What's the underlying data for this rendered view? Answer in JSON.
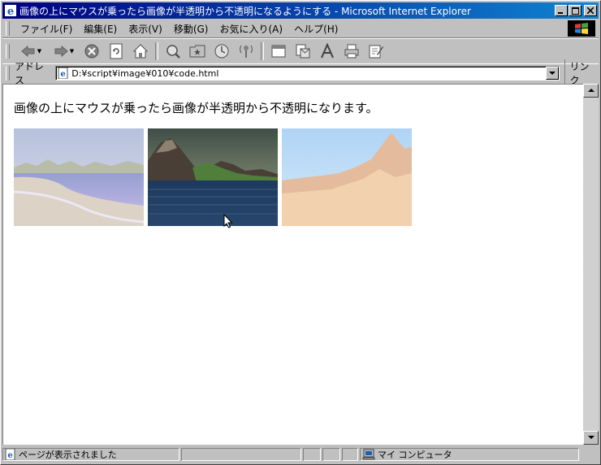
{
  "window": {
    "title": "画像の上にマウスが乗ったら画像が半透明から不透明になるようにする - Microsoft Internet Explorer"
  },
  "menu": [
    "ファイル(F)",
    "編集(E)",
    "表示(V)",
    "移動(G)",
    "お気に入り(A)",
    "ヘルプ(H)"
  ],
  "toolbar": {
    "buttons": [
      "back-icon",
      "forward-icon",
      "stop-icon",
      "refresh-icon",
      "home-icon",
      "search-icon",
      "favorites-icon",
      "history-icon",
      "channels-icon",
      "fullscreen-icon",
      "mail-icon",
      "font-icon",
      "print-icon",
      "edit-icon"
    ]
  },
  "address": {
    "label": "アドレス",
    "value": "D:¥script¥image¥010¥code.html",
    "links_label": "リンク"
  },
  "page": {
    "heading": "画像の上にマウスが乗ったら画像が半透明から不透明になります。",
    "images": [
      {
        "name": "beach-landscape",
        "opacity": 0.5
      },
      {
        "name": "mountain-sea-landscape",
        "opacity": 1.0
      },
      {
        "name": "desert-peak-landscape",
        "opacity": 0.5
      }
    ]
  },
  "status": {
    "message": "ページが表示されました",
    "zone": "マイ コンピュータ"
  },
  "colors": {
    "titlebar_start": "#000080",
    "titlebar_end": "#1084d0",
    "chrome": "#c0c0c0"
  }
}
